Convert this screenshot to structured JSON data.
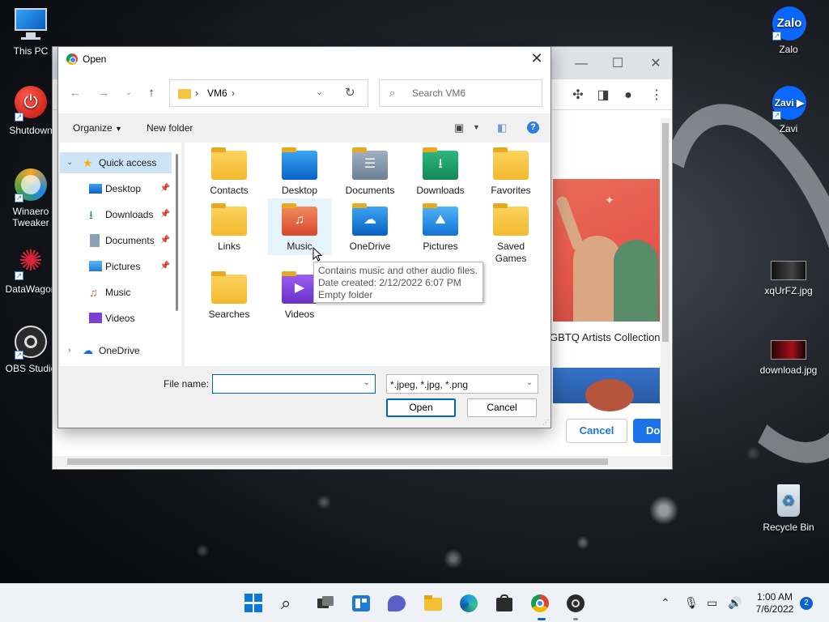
{
  "desktop": {
    "icons_left": [
      {
        "name": "This PC"
      },
      {
        "name": "Shutdown"
      },
      {
        "name": "Winaero Tweaker"
      },
      {
        "name": "DataWagon"
      },
      {
        "name": "OBS Studio"
      }
    ],
    "icons_right": [
      {
        "name": "Zalo"
      },
      {
        "name": "Zavi"
      },
      {
        "name": "xqUrFZ.jpg"
      },
      {
        "name": "download.jpg"
      },
      {
        "name": "Recycle Bin"
      }
    ]
  },
  "browser": {
    "caption": "GBTQ Artists Collection",
    "cancel_label": "Cancel",
    "do_label": "Do"
  },
  "dialog": {
    "title": "Open",
    "address": {
      "crumb": "VM6"
    },
    "search_placeholder": "Search VM6",
    "commands": {
      "organize": "Organize",
      "new_folder": "New folder",
      "help": "?"
    },
    "nav": [
      {
        "label": "Quick access",
        "selected": true
      },
      {
        "label": "Desktop",
        "pinned": true
      },
      {
        "label": "Downloads",
        "pinned": true
      },
      {
        "label": "Documents",
        "pinned": true
      },
      {
        "label": "Pictures",
        "pinned": true
      },
      {
        "label": "Music"
      },
      {
        "label": "Videos"
      },
      {
        "label": "OneDrive"
      }
    ],
    "items": [
      {
        "label": "Contacts",
        "icon": "folder-icon"
      },
      {
        "label": "Desktop",
        "icon": "desktop-folder-icon"
      },
      {
        "label": "Documents",
        "icon": "documents-folder-icon"
      },
      {
        "label": "Downloads",
        "icon": "downloads-folder-icon"
      },
      {
        "label": "Favorites",
        "icon": "folder-icon"
      },
      {
        "label": "Links",
        "icon": "folder-icon"
      },
      {
        "label": "Music",
        "icon": "music-folder-icon"
      },
      {
        "label": "OneDrive",
        "icon": "onedrive-folder-icon"
      },
      {
        "label": "Pictures",
        "icon": "pictures-folder-icon"
      },
      {
        "label": "Saved Games",
        "icon": "folder-icon"
      },
      {
        "label": "Searches",
        "icon": "folder-icon"
      },
      {
        "label": "Videos",
        "icon": "videos-folder-icon"
      }
    ],
    "tooltip": {
      "line1": "Contains music and other audio files.",
      "line2": "Date created: 2/12/2022 6:07 PM",
      "line3": "Empty folder"
    },
    "file_name_label": "File name:",
    "file_name_value": "",
    "file_type": "*.jpeg, *.jpg, *.png",
    "open_label": "Open",
    "cancel_label": "Cancel"
  },
  "taskbar": {
    "time": "1:00 AM",
    "date": "7/6/2022",
    "notifications": "2"
  }
}
